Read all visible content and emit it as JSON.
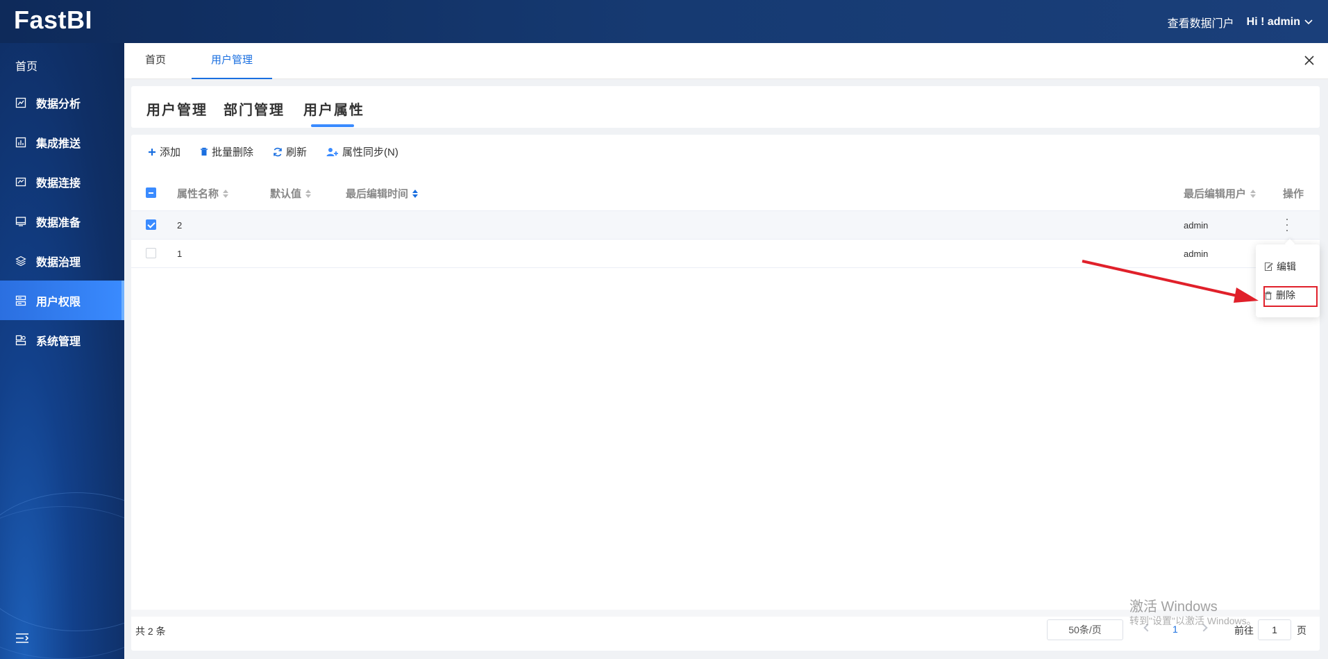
{
  "app": {
    "logo": "FastBI"
  },
  "header": {
    "portal_link": "查看数据门户",
    "user_greeting": "Hi ! admin"
  },
  "sidebar": {
    "home": "首页",
    "items": [
      {
        "label": "数据分析",
        "icon": "chart-analysis-icon"
      },
      {
        "label": "集成推送",
        "icon": "bar-chart-icon"
      },
      {
        "label": "数据连接",
        "icon": "connection-icon"
      },
      {
        "label": "数据准备",
        "icon": "monitor-icon"
      },
      {
        "label": "数据治理",
        "icon": "layers-icon"
      },
      {
        "label": "用户权限",
        "icon": "user-permission-icon",
        "active": true
      },
      {
        "label": "系统管理",
        "icon": "system-icon"
      }
    ]
  },
  "tabs": [
    {
      "label": "首页"
    },
    {
      "label": "用户管理",
      "active": true
    }
  ],
  "subtabs": [
    {
      "label": "用户管理"
    },
    {
      "label": "部门管理"
    },
    {
      "label": "用户属性",
      "active": true
    }
  ],
  "toolbar": {
    "add": "添加",
    "batch_delete": "批量删除",
    "refresh": "刷新",
    "sync": "属性同步(N)"
  },
  "table": {
    "columns": {
      "name": "属性名称",
      "default": "默认值",
      "last_edit_time": "最后编辑时间",
      "last_edit_user": "最后编辑用户",
      "actions": "操作"
    },
    "rows": [
      {
        "name": "2",
        "default": "",
        "last_edit_time": "",
        "last_edit_user": "admin",
        "checked": true
      },
      {
        "name": "1",
        "default": "",
        "last_edit_time": "",
        "last_edit_user": "admin",
        "checked": false
      }
    ]
  },
  "row_menu": {
    "edit": "编辑",
    "delete": "删除"
  },
  "footer": {
    "total": "共 2 条",
    "page_size": "50条/页",
    "current_page": "1",
    "goto_label": "前往",
    "goto_value": "1",
    "page_unit": "页"
  },
  "watermark": {
    "line1": "激活 Windows",
    "line2": "转到\"设置\"以激活 Windows。"
  },
  "colors": {
    "accent": "#1a6fe0",
    "highlight_box": "#e0202a",
    "sidebar_active": "#3a8bff"
  }
}
